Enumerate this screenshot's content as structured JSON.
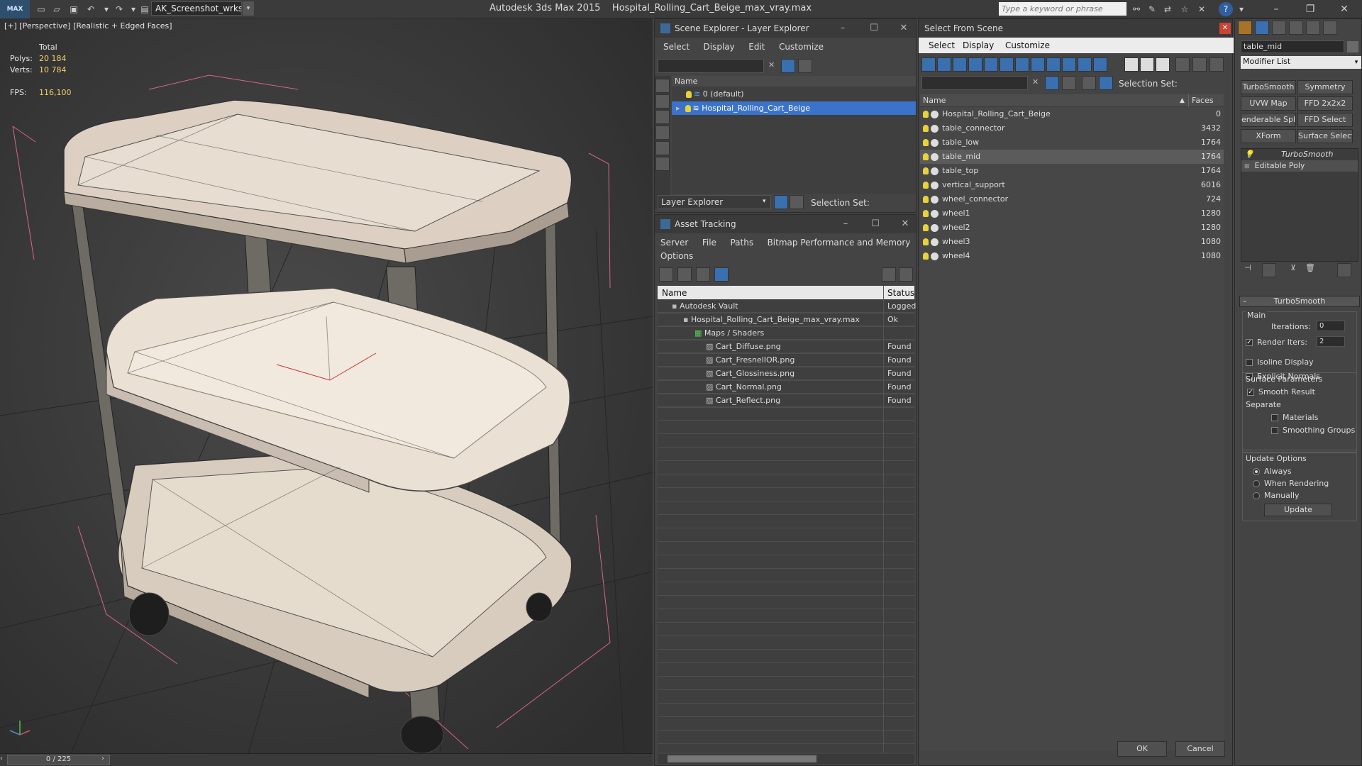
{
  "titlebar": {
    "logo": "MAX",
    "workspace": "AK_Screenshot_wrksp",
    "app_name": "Autodesk 3ds Max  2015",
    "file_name": "Hospital_Rolling_Cart_Beige_max_vray.max",
    "search_placeholder": "Type a keyword or phrase"
  },
  "viewport": {
    "label": "[+] [Perspective] [Realistic + Edged Faces]",
    "stats": {
      "total_label": "Total",
      "polys_label": "Polys:",
      "polys": "20 184",
      "verts_label": "Verts:",
      "verts": "10 784",
      "fps_label": "FPS:",
      "fps": "116,100"
    },
    "timeline": "0 / 225"
  },
  "scene_explorer": {
    "title": "Scene Explorer - Layer Explorer",
    "menu": [
      "Select",
      "Display",
      "Edit",
      "Customize"
    ],
    "col_name": "Name",
    "layers": [
      "0 (default)",
      "Hospital_Rolling_Cart_Beige"
    ],
    "footer_dropdown": "Layer Explorer",
    "selection_set": "Selection Set:"
  },
  "asset_tracking": {
    "title": "Asset Tracking",
    "menu": [
      "Server",
      "File",
      "Paths",
      "Bitmap Performance and Memory"
    ],
    "menu2": "Options",
    "col_name": "Name",
    "col_status": "Status",
    "rows": [
      {
        "name": "Autodesk Vault",
        "status": "Logged",
        "indent": 0
      },
      {
        "name": "Hospital_Rolling_Cart_Beige_max_vray.max",
        "status": "Ok",
        "indent": 1
      },
      {
        "name": "Maps / Shaders",
        "status": "",
        "indent": 2
      },
      {
        "name": "Cart_Diffuse.png",
        "status": "Found",
        "indent": 3
      },
      {
        "name": "Cart_FresnelIOR.png",
        "status": "Found",
        "indent": 3
      },
      {
        "name": "Cart_Glossiness.png",
        "status": "Found",
        "indent": 3
      },
      {
        "name": "Cart_Normal.png",
        "status": "Found",
        "indent": 3
      },
      {
        "name": "Cart_Reflect.png",
        "status": "Found",
        "indent": 3
      }
    ]
  },
  "select_from_scene": {
    "title": "Select From Scene",
    "menu": [
      "Select",
      "Display",
      "Customize"
    ],
    "selection_set": "Selection Set:",
    "col_name": "Name",
    "col_faces": "Faces",
    "objects": [
      {
        "name": "Hospital_Rolling_Cart_Beige",
        "faces": "0"
      },
      {
        "name": "table_connector",
        "faces": "3432"
      },
      {
        "name": "table_low",
        "faces": "1764"
      },
      {
        "name": "table_mid",
        "faces": "1764"
      },
      {
        "name": "table_top",
        "faces": "1764"
      },
      {
        "name": "vertical_support",
        "faces": "6016"
      },
      {
        "name": "wheel_connector",
        "faces": "724"
      },
      {
        "name": "wheel1",
        "faces": "1280"
      },
      {
        "name": "wheel2",
        "faces": "1280"
      },
      {
        "name": "wheel3",
        "faces": "1080"
      },
      {
        "name": "wheel4",
        "faces": "1080"
      }
    ],
    "ok": "OK",
    "cancel": "Cancel"
  },
  "modify_panel": {
    "object_name": "table_mid",
    "modifier_list": "Modifier List",
    "buttons": [
      "TurboSmooth",
      "Symmetry",
      "UVW Map",
      "FFD 2x2x2",
      "enderable Splin",
      "FFD Select",
      "XForm",
      "Surface Select"
    ],
    "stack": [
      "TurboSmooth",
      "Editable Poly"
    ],
    "rollout_title": "TurboSmooth",
    "main_label": "Main",
    "iterations_label": "Iterations:",
    "iterations": "0",
    "render_iters_label": "Render Iters:",
    "render_iters": "2",
    "isoline": "Isoline Display",
    "explicit_normals": "Explicit Normals",
    "surface_params": "Surface Parameters",
    "smooth_result": "Smooth Result",
    "separate": "Separate",
    "materials": "Materials",
    "smoothing_groups": "Smoothing Groups",
    "update_options": "Update Options",
    "always": "Always",
    "when_rendering": "When Rendering",
    "manually": "Manually",
    "update": "Update"
  }
}
